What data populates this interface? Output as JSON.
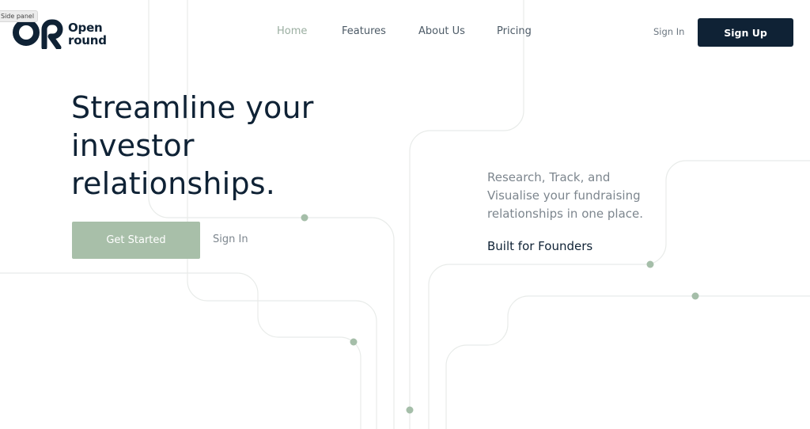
{
  "side_panel": {
    "label": "Side panel"
  },
  "brand": {
    "line1": "Open",
    "line2": "round"
  },
  "nav": {
    "items": [
      {
        "label": "Home",
        "active": true
      },
      {
        "label": "Features",
        "active": false
      },
      {
        "label": "About Us",
        "active": false
      },
      {
        "label": "Pricing",
        "active": false
      }
    ]
  },
  "header": {
    "sign_in": "Sign In",
    "sign_up": "Sign Up"
  },
  "hero": {
    "title": "Streamline your investor relationships.",
    "cta_primary": "Get Started",
    "cta_secondary": "Sign In",
    "tagline": "Research, Track, and Visualise your fundraising relationships in one place.",
    "built_for": "Built for Founders"
  },
  "colors": {
    "navy": "#0f2235",
    "sage": "#a8bfa9",
    "muted_text": "#7d868e",
    "line": "#e8ebe9"
  }
}
